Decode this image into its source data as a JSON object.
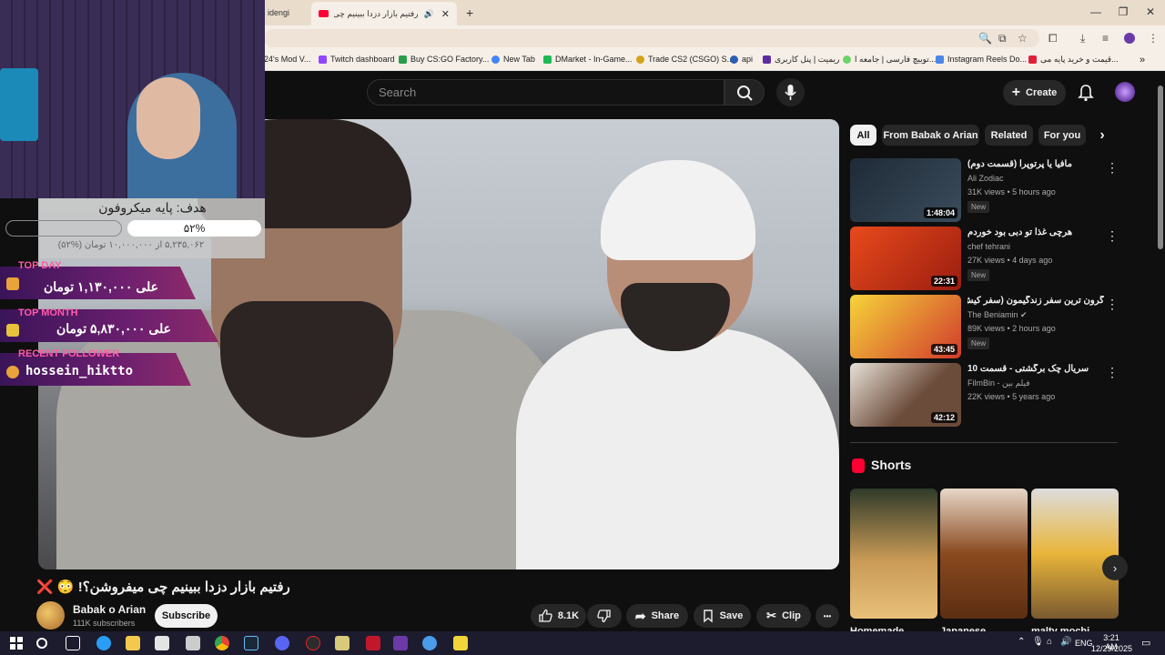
{
  "browser": {
    "tabs": [
      {
        "label": "idengi"
      },
      {
        "label": "رفتیم بازار دزدا ببینیم چی میف"
      }
    ],
    "bookmarks": [
      {
        "label": "24's Mod V...",
        "color": "#666"
      },
      {
        "label": "Twitch dashboard",
        "color": "#9146ff"
      },
      {
        "label": "Buy CS:GO Factory...",
        "color": "#2a9d4a"
      },
      {
        "label": "New Tab",
        "color": "#4285f4"
      },
      {
        "label": "DMarket - In-Game...",
        "color": "#1db954"
      },
      {
        "label": "Trade CS2 (CSGO) S...",
        "color": "#d4a21a"
      },
      {
        "label": "api",
        "color": "#2a5db0"
      },
      {
        "label": "ریمیت | پنل کاربری",
        "color": "#5b2ca0"
      },
      {
        "label": "توییچ فارسی | جامعه ا...",
        "color": "#6ad46a"
      },
      {
        "label": "Instagram Reels Do...",
        "color": "#4a86e8"
      },
      {
        "label": "قیمت و خرید پایه می...",
        "color": "#e0203a"
      }
    ]
  },
  "header": {
    "search_placeholder": "Search",
    "create_label": "Create"
  },
  "overlay": {
    "goal_title": "هدف: پایه میکروفون",
    "goal_percent": "۵۲%",
    "goal_sub": "۵,۲۳۵,۰۶۲ از ۱۰,۰۰۰,۰۰۰ تومان (%۵۲)",
    "top_day_label": "TOP DAY",
    "top_day_text": "علی ۱,۱۳۰,۰۰۰ تومان",
    "top_month_label": "TOP MONTH",
    "top_month_text": "علی ۵,۸۳۰,۰۰۰ تومان",
    "follower_label": "RECENT FOLLOWER",
    "follower_text": "hossein_hiktto"
  },
  "video": {
    "title": "❌ 😳 !رفتیم بازار دزدا ببینیم چی میفروشن؟",
    "channel": "Babak o Arian",
    "subscribers": "111K subscribers",
    "subscribe_label": "Subscribe",
    "likes": "8.1K",
    "share_label": "Share",
    "save_label": "Save",
    "clip_label": "Clip",
    "more_label": "•••"
  },
  "chips": [
    {
      "label": "All",
      "active": true
    },
    {
      "label": "From Babak o Arian"
    },
    {
      "label": "Related"
    },
    {
      "label": "For you"
    }
  ],
  "recommendations": [
    {
      "title": "مافیا یا پرتوپرا (قسمت دوم)",
      "channel": "Ali Zodiac",
      "stats": "31K views • 5 hours ago",
      "badge": "New",
      "duration": "1:48:04",
      "thumb_color": "#1e2a36"
    },
    {
      "title": "هرچی غذا تو دبی بود خوردم",
      "channel": "chef tehrani",
      "stats": "27K views • 4 days ago",
      "badge": "New",
      "duration": "22:31",
      "thumb_color": "#c93a1c"
    },
    {
      "title": "گرون ترین سفر زندگیمون (سفر کیش) 🆒",
      "channel": "The Beniamin ✔",
      "stats": "89K views • 2 hours ago",
      "badge": "New",
      "duration": "43:45",
      "thumb_color": "#f0c21a"
    },
    {
      "title": "سریال چک برگشتی - قسمت 10",
      "channel": "FilmBin - فیلم بین",
      "stats": "22K views • 5 years ago",
      "badge": "",
      "duration": "42:12",
      "thumb_color": "#6b4b3a"
    }
  ],
  "shorts": {
    "title": "Shorts",
    "items": [
      {
        "label": "Homemade",
        "color": "#b78a45"
      },
      {
        "label": "Japanese",
        "color": "#8a4a1f"
      },
      {
        "label": "malty mochi",
        "color": "#d8b33a"
      }
    ]
  },
  "taskbar": {
    "lang": "ENG",
    "time": "3:21 AM",
    "date": "12/29/2025"
  }
}
